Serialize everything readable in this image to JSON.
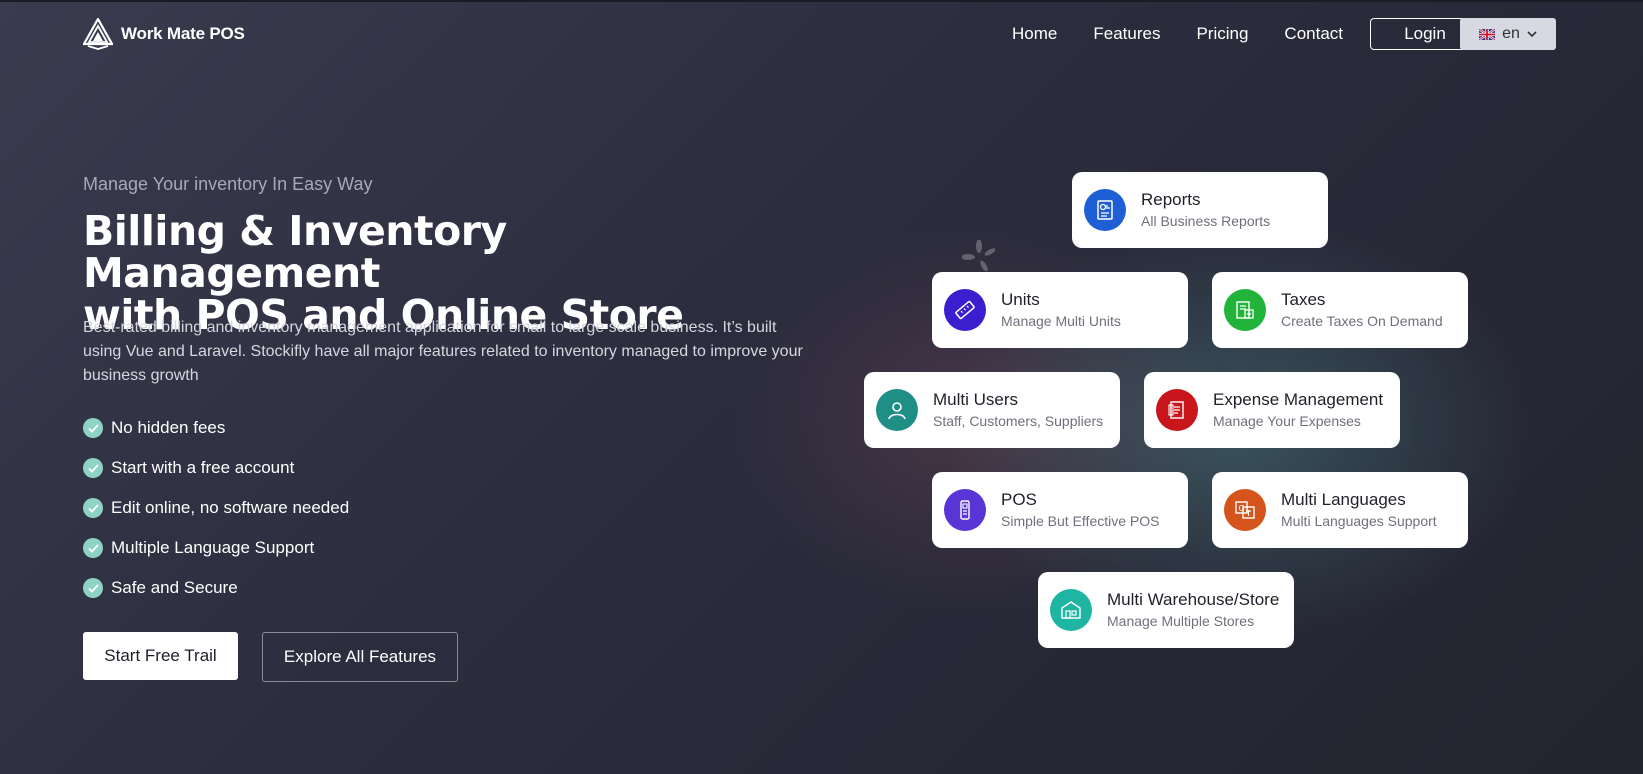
{
  "brand": {
    "name": "Work Mate POS"
  },
  "nav": {
    "items": [
      "Home",
      "Features",
      "Pricing",
      "Contact"
    ],
    "login_label": "Login",
    "language": "en"
  },
  "hero": {
    "tagline": "Manage Your inventory In Easy Way",
    "title_line1": "Billing & Inventory Management",
    "title_line2": "with POS and Online Store",
    "description": "Best-rated billing and inventory management application for small to large scale business. It’s built using Vue and Laravel. Stockifly have all major features related to inventory managed to improve your business growth",
    "checks": [
      "No hidden fees",
      "Start with a free account",
      "Edit online, no software needed",
      "Multiple Language Support",
      "Safe and Secure"
    ],
    "primary_cta": "Start Free Trail",
    "secondary_cta": "Explore All Features"
  },
  "features": [
    {
      "title": "Reports",
      "subtitle": "All Business Reports",
      "icon": "report-icon",
      "color": "#1f5fd6"
    },
    {
      "title": "Units",
      "subtitle": "Manage Multi Units",
      "icon": "ruler-icon",
      "color": "#3b1fcf"
    },
    {
      "title": "Taxes",
      "subtitle": "Create Taxes On Demand",
      "icon": "tax-icon",
      "color": "#22b33a"
    },
    {
      "title": "Multi Users",
      "subtitle": "Staff, Customers, Suppliers",
      "icon": "user-icon",
      "color": "#1f8f86"
    },
    {
      "title": "Expense Management",
      "subtitle": "Manage Your Expenses",
      "icon": "expense-icon",
      "color": "#c8161c"
    },
    {
      "title": "POS",
      "subtitle": "Simple But Effective POS",
      "icon": "pos-icon",
      "color": "#5a35d6"
    },
    {
      "title": "Multi Languages",
      "subtitle": "Multi Languages Support",
      "icon": "translate-icon",
      "color": "#d4541b"
    },
    {
      "title": "Multi Warehouse/Store",
      "subtitle": "Manage Multiple Stores",
      "icon": "warehouse-icon",
      "color": "#1fb5a3"
    }
  ]
}
